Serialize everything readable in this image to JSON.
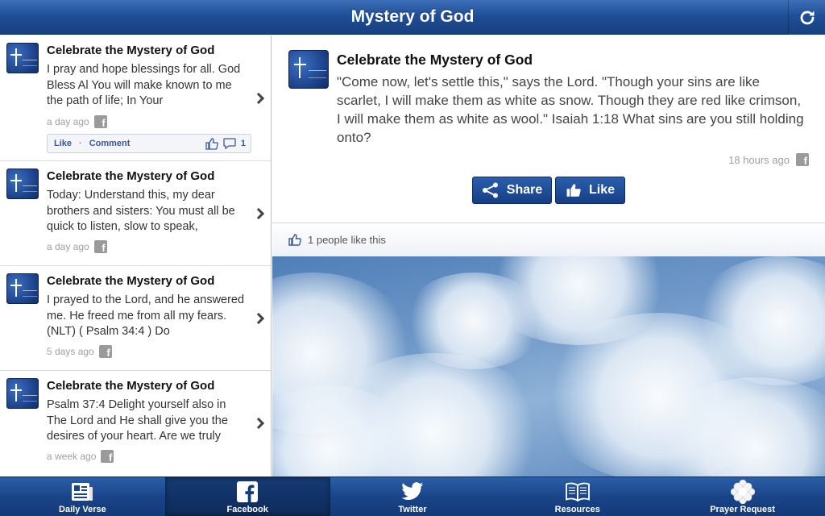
{
  "header": {
    "title": "Mystery of God"
  },
  "posts": [
    {
      "title": "Celebrate the Mystery of God",
      "body": "I pray and hope blessings for all. God Bless Al You will make known to me the path of life; In Your",
      "time": "a day ago",
      "like_label": "Like",
      "comment_label": "Comment",
      "comment_count": "1"
    },
    {
      "title": "Celebrate the Mystery of God",
      "body": "Today: Understand this, my dear brothers and sisters: You must all be quick to listen, slow to speak,",
      "time": "a day ago"
    },
    {
      "title": "Celebrate the Mystery of God",
      "body": "I prayed to the Lord, and he answered me. He freed me from all my fears. (NLT) ( Psalm 34:4 ) Do",
      "time": "5 days ago"
    },
    {
      "title": "Celebrate the Mystery of God",
      "body": "Psalm 37:4 Delight yourself also in The Lord and He shall give you the desires of your heart. Are we truly",
      "time": "a week ago"
    }
  ],
  "detail": {
    "title": "Celebrate the Mystery of God",
    "body": "\"Come now, let's settle this,\" says the Lord. \"Though your sins are like scarlet, I will make them as white as snow. Though they are red like crimson, I will make them as white as wool.\" Isaiah 1:18 What sins are you still holding onto?",
    "time": "18 hours ago",
    "share_label": "Share",
    "like_label": "Like",
    "likes_text": "1 people like this"
  },
  "tabs": [
    {
      "label": "Daily Verse",
      "icon": "newspaper-icon"
    },
    {
      "label": "Facebook",
      "icon": "facebook-icon",
      "active": true
    },
    {
      "label": "Twitter",
      "icon": "twitter-bird-icon"
    },
    {
      "label": "Resources",
      "icon": "open-book-icon"
    },
    {
      "label": "Prayer Request",
      "icon": "flower-icon"
    }
  ],
  "colors": {
    "brand_blue": "#1f4f98",
    "facebook_blue": "#3b5998"
  }
}
